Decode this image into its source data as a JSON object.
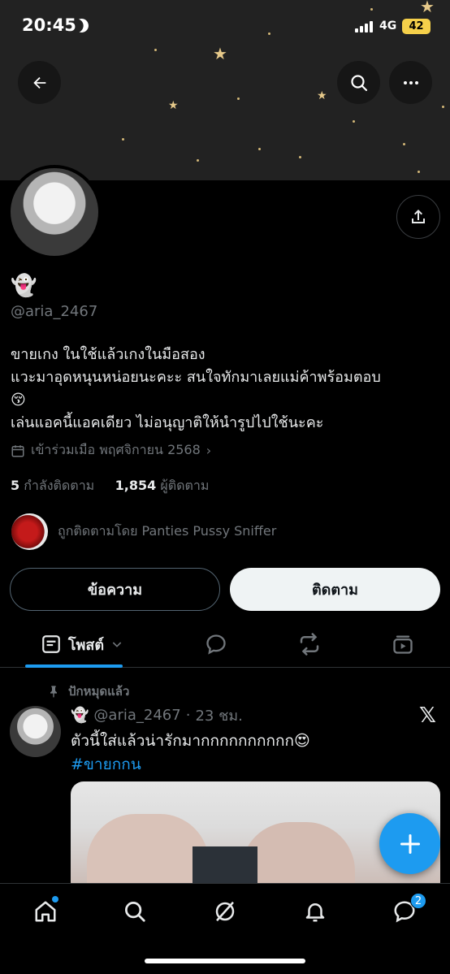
{
  "status_bar": {
    "time": "20:45",
    "network": "4G",
    "battery": "42"
  },
  "colors": {
    "accent": "#1d9bf0",
    "background": "#000000",
    "muted": "#71767b",
    "battery": "#f5d04a"
  },
  "header": {
    "back_icon": "arrow-left-icon",
    "search_icon": "search-icon",
    "more_icon": "more-icon"
  },
  "profile": {
    "display_name": "👻",
    "handle": "@aria_2467",
    "bio_lines": [
      "ขายเกง ในใช้แล้วเกงในมือสอง",
      "แวะมาอุดหนุนหน่อยนะคะะ สนใจทักมาเลยแม่ค้าพร้อมตอบ",
      "😚",
      "เล่นแอคนี้แอคเดียว ไม่อนุญาติให้นำรูปไปใช้นะคะ"
    ],
    "joined": "เข้าร่วมเมือ พฤศจิกายน 2568",
    "following_count": "5",
    "following_label": "กำลังติดตาม",
    "followers_count": "1,854",
    "followers_label": "ผู้ติดตาม",
    "followed_by": "ถูกติดตามโดย Panties Pussy Sniffer"
  },
  "actions": {
    "message_label": "ข้อความ",
    "follow_label": "ติดตาม"
  },
  "tabs": {
    "posts_label": "โพสต์"
  },
  "post": {
    "pinned_label": "ปักหมุดแล้ว",
    "author_emoji": "👻",
    "author_handle": "@aria_2467",
    "time": "23 ชม.",
    "text": "ตัวนี้ใส่แล้วน่ารักมากกกกกกกกกก😍",
    "hashtag": "#ขายกกน"
  },
  "nav": {
    "messages_badge": "2"
  }
}
